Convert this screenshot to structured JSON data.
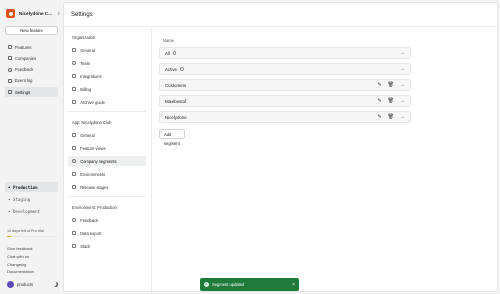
{
  "org": {
    "name": "Nicelydone C..."
  },
  "sidebar": {
    "new_feature_label": "New feature",
    "items": [
      {
        "label": "Features",
        "icon": "flag-icon"
      },
      {
        "label": "Companies",
        "icon": "building-icon"
      },
      {
        "label": "Feedback",
        "icon": "chat-icon"
      },
      {
        "label": "Event log",
        "icon": "list-icon"
      },
      {
        "label": "Settings",
        "icon": "gear-icon",
        "active": true
      }
    ],
    "environments": [
      {
        "label": "Production",
        "active": true
      },
      {
        "label": "Staging"
      },
      {
        "label": "Development"
      }
    ],
    "trial_text": "14 days left of Pro trial",
    "trial_progress": 0.08,
    "links": [
      "Give feedback",
      "Chat with us",
      "Changelog",
      "Documentation"
    ],
    "footer_label": "products"
  },
  "header": {
    "title": "Settings"
  },
  "settings_nav": {
    "org_title": "Organization",
    "org_items": [
      "General",
      "Team",
      "Integrations",
      "Billing",
      "Archive guide"
    ],
    "app_title": "App: Nicelydone Club",
    "app_items": [
      "General",
      "Feature views",
      "Company segments",
      "Environments",
      "Release stages"
    ],
    "env_title": "Environment: Production",
    "env_items": [
      "Feedback",
      "Data export",
      "Slack"
    ]
  },
  "segments": {
    "column_header": "Name",
    "rows": [
      {
        "name": "All",
        "info": true,
        "editable": false
      },
      {
        "name": "Active",
        "info": true,
        "editable": false
      },
      {
        "name": "Customers",
        "info": false,
        "editable": true
      },
      {
        "name": "Maxibestof",
        "info": false,
        "editable": true
      },
      {
        "name": "Nicelydone",
        "info": false,
        "editable": true
      }
    ],
    "add_label": "Add segment"
  },
  "toast": {
    "message": "Segment updated"
  },
  "colors": {
    "accent": "#e0521a",
    "toast_bg": "#1f7a3c",
    "trial_bar": "#e6a11e"
  }
}
